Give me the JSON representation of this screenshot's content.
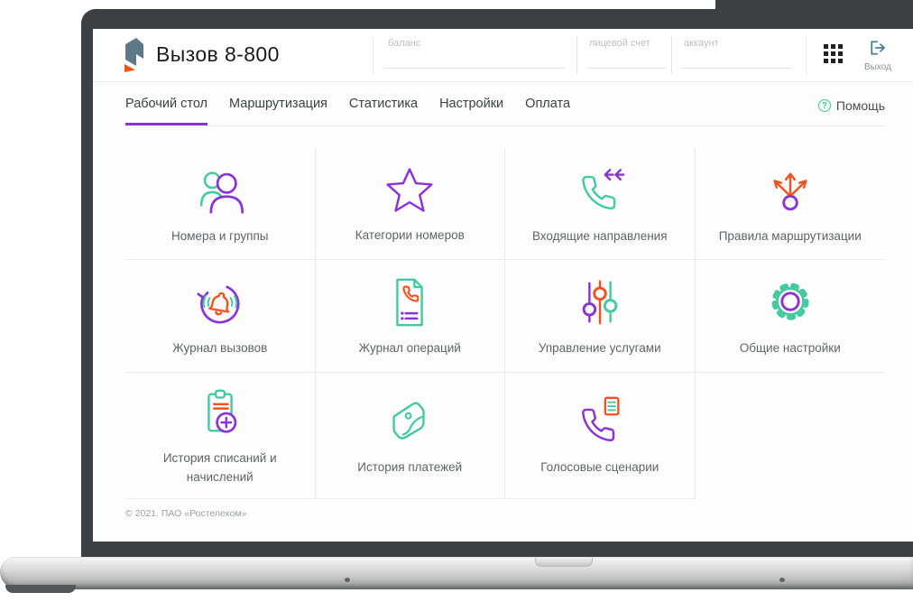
{
  "header": {
    "app_title": "Вызов 8-800",
    "fields": [
      {
        "label": "баланс"
      },
      {
        "label": "лицевой счет"
      },
      {
        "label": "аккаунт"
      }
    ],
    "logout_label": "Выход"
  },
  "nav": {
    "tabs": [
      {
        "label": "Рабочий стол",
        "active": true
      },
      {
        "label": "Маршрутизация",
        "active": false
      },
      {
        "label": "Статистика",
        "active": false
      },
      {
        "label": "Настройки",
        "active": false
      },
      {
        "label": "Оплата",
        "active": false
      }
    ],
    "help_label": "Помощь",
    "help_icon_glyph": "?"
  },
  "tiles": [
    {
      "label": "Номера и группы",
      "icon": "users-icon"
    },
    {
      "label": "Категории номеров",
      "icon": "star-icon"
    },
    {
      "label": "Входящие направления",
      "icon": "incoming-call-icon"
    },
    {
      "label": "Правила маршрутизации",
      "icon": "routing-branch-icon"
    },
    {
      "label": "Журнал вызовов",
      "icon": "call-log-icon"
    },
    {
      "label": "Журнал операций",
      "icon": "operations-log-icon"
    },
    {
      "label": "Управление услугами",
      "icon": "sliders-icon"
    },
    {
      "label": "Общие настройки",
      "icon": "gear-icon"
    },
    {
      "label": "История списаний и начислений",
      "icon": "clipboard-plus-icon"
    },
    {
      "label": "История платежей",
      "icon": "wallet-icon"
    },
    {
      "label": "Голосовые сценарии",
      "icon": "voice-script-icon"
    }
  ],
  "footer": {
    "copyright": "© 2021. ПАО «Ростелеком»"
  },
  "colors": {
    "purple": "#8a33d6",
    "teal": "#45c9a1",
    "orange": "#f4511e",
    "help_green": "#36c98f",
    "exit_blue": "#4d7d94",
    "logo_slate": "#5d7886",
    "logo_orange": "#ff4f12"
  }
}
